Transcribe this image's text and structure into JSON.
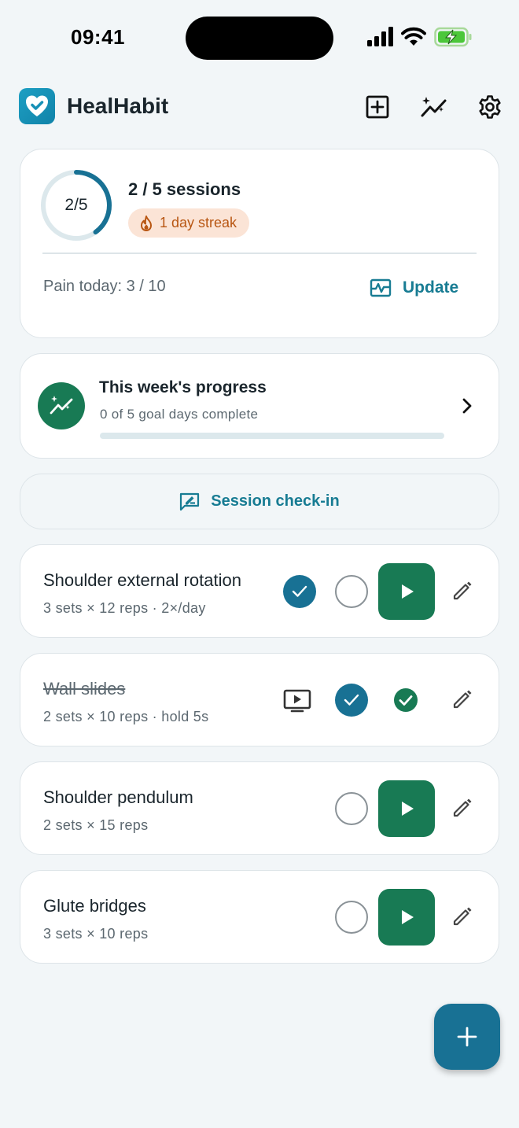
{
  "status_bar": {
    "time": "09:41"
  },
  "header": {
    "app_title": "HealHabit"
  },
  "summary": {
    "ring_label": "2/5",
    "sessions_done": 2,
    "sessions_total": 5,
    "sessions_text": "2 / 5 sessions",
    "streak_text": "1 day streak",
    "pain_text": "Pain today: 3 / 10",
    "update_label": "Update"
  },
  "weekly_progress": {
    "title": "This week's progress",
    "subtitle": "0 of 5 goal days complete",
    "fraction": 0
  },
  "checkin": {
    "label": "Session check-in"
  },
  "exercises": [
    {
      "name": "Shoulder external rotation",
      "detail": "3 sets × 12 reps · 2×/day",
      "done": false
    },
    {
      "name": "Wall slides",
      "detail": "2 sets × 10 reps · hold 5s",
      "done": true
    },
    {
      "name": "Shoulder pendulum",
      "detail": "2 sets × 15 reps",
      "done": false
    },
    {
      "name": "Glute bridges",
      "detail": "3 sets × 10 reps",
      "done": false
    }
  ],
  "colors": {
    "accent": "#187194",
    "accent_text": "#187c93",
    "green": "#187a54",
    "streak_bg": "#fbe4d6",
    "streak_text": "#b85612",
    "background": "#f2f6f8"
  },
  "icons": {
    "header": [
      "add-box-icon",
      "trend-sparkle-icon",
      "gear-icon"
    ],
    "logo": "heart-check-icon",
    "streak": "flame-icon",
    "update": "heart-rate-chart-icon",
    "progress": "trend-sparkle-icon",
    "checkin": "feedback-icon",
    "fab": "plus-icon"
  }
}
